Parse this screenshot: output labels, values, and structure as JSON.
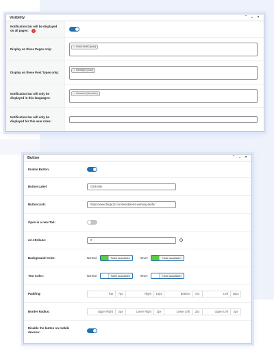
{
  "visibility": {
    "title": "Visibility",
    "rows": {
      "all_pages": {
        "label": "Notification bar will be displayed on all pages:",
        "warning": "!"
      },
      "pages": {
        "label": "Display on these Pages only:",
        "chip": "Hallo Welt! (post)"
      },
      "post_types": {
        "label": "Display on these Post Types only:",
        "chip": "Beiträge (post)"
      },
      "languages": {
        "label": "Notification bar will only be displayed in this languages:",
        "chip": "Deutsch (Deutsch)"
      },
      "user_roles": {
        "label": "Notification bar will only be displayed for this user roles:"
      }
    }
  },
  "button": {
    "title": "Button",
    "enable": {
      "label": "Enable Button:"
    },
    "label_field": {
      "label": "Button Label:",
      "value": "Click Me!"
    },
    "link": {
      "label": "Button Link:",
      "value": "https://www.forge12.com/wordpress-wartung-tarife/"
    },
    "new_tab": {
      "label": "Open in a new Tab:"
    },
    "rel": {
      "label": "rel Attribute:",
      "value": "0",
      "info": "i"
    },
    "bg_color": {
      "label": "Background Color:",
      "normal": "Normal:",
      "hover": "Hover:",
      "choose": "Farbe auswählen",
      "normal_color": "#5ccc3e",
      "hover_color": "#5ccc3e"
    },
    "text_color": {
      "label": "Text Color:",
      "normal": "Normal:",
      "hover": "Hover:",
      "choose": "Farbe auswählen",
      "normal_color": "#ffffff",
      "hover_color": "#ffffff"
    },
    "padding": {
      "label": "Padding:",
      "top": "Top",
      "top_val": "7px",
      "right": "Right",
      "right_val": "10px",
      "bottom": "Bottom",
      "bottom_val": "7px",
      "left": "Left",
      "left_val": "10px"
    },
    "radius": {
      "label": "Border Radius:",
      "ur": "Upper Right",
      "ur_val": "2px",
      "lr": "Lower Right",
      "lr_val": "2px",
      "ll": "Lower Left",
      "ll_val": "2px",
      "ul": "Upper Left",
      "ul_val": "2px"
    },
    "mobile": {
      "label": "Disable the button on mobile devices:"
    }
  },
  "icons": {
    "collapse_up": "⌃",
    "collapse_down": "⌄",
    "toggle_panel": "▾"
  },
  "colors": {
    "accent": "#2271b1",
    "warning": "#d63638",
    "swatch_green": "#5ccc3e"
  }
}
